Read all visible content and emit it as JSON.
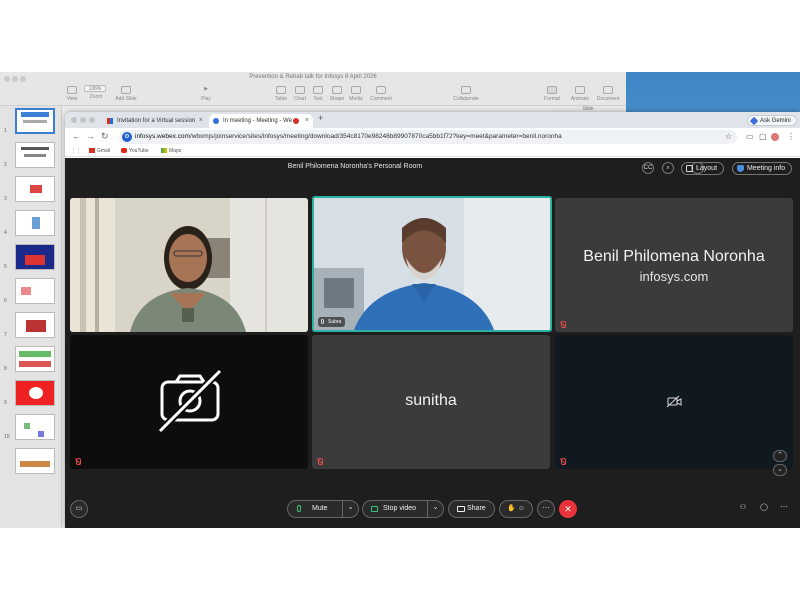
{
  "keynote": {
    "title": "Prevention & Rehab talk for Infosys 8 April 2026",
    "zoom": "136%",
    "toolbar": [
      "View",
      "Zoom",
      "Add Slide",
      "Play",
      "Table",
      "Chart",
      "Text",
      "Shape",
      "Media",
      "Comment",
      "Collaborate",
      "Format",
      "Animate",
      "Document"
    ],
    "slide_tab": "Slide",
    "slide_numbers": [
      "1",
      "2",
      "3",
      "4",
      "5",
      "6",
      "7",
      "8",
      "9",
      "10"
    ]
  },
  "browser": {
    "tabs": [
      {
        "label": "Invitation for a Virtual session"
      },
      {
        "label": "In meeting - Meeting - We"
      }
    ],
    "new_tab": "+",
    "ask_gemini": "Ask Gemini",
    "url_domain": "infosys.webex.com",
    "url_path": "/wbxmjs/joinservice/sites/infosys/meeting/download/354c8170e98248b89907870ca5bb1f72?key=meet&parameter=benil.noronha",
    "bookmarks": [
      "Gmail",
      "YouTube",
      "Maps"
    ]
  },
  "webex": {
    "room_title": "Benil Philomena Noronha's Personal Room",
    "cc": "CC",
    "layout": "Layout",
    "meeting_info": "Meeting info",
    "tiles": [
      {
        "type": "video"
      },
      {
        "type": "video",
        "name": "Subra",
        "active": true
      },
      {
        "type": "name",
        "name": "Benil Philomena Noronha",
        "subtitle": "infosys.com"
      },
      {
        "type": "camera-off"
      },
      {
        "type": "name",
        "name": "sunitha"
      },
      {
        "type": "camera-off-small"
      }
    ],
    "controls": {
      "mute": "Mute",
      "stop_video": "Stop video",
      "share": "Share"
    }
  },
  "colors": {
    "accent": "#2bb3a2",
    "leave": "#e8333a",
    "muted": "#e04b4b"
  }
}
